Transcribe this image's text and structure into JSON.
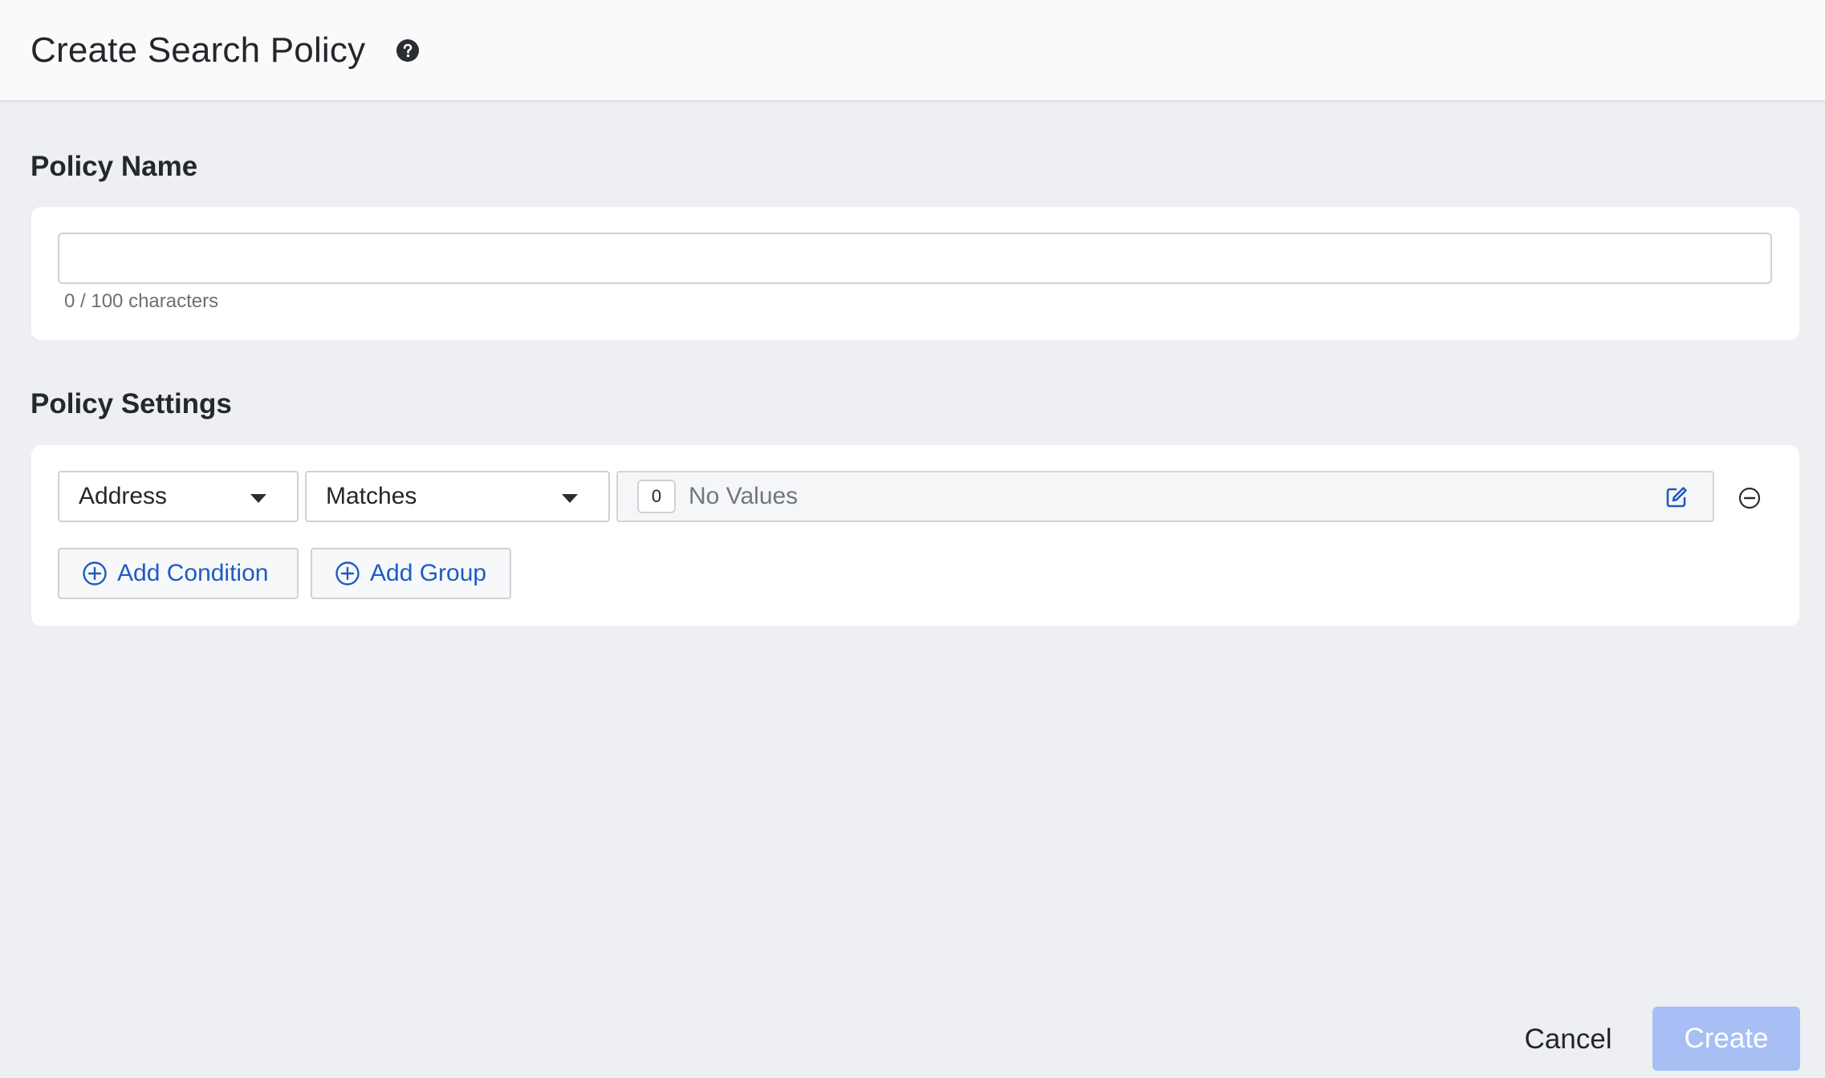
{
  "header": {
    "title": "Create Search Policy",
    "help_icon": "question-circle-icon"
  },
  "policy_name": {
    "label": "Policy Name",
    "input_value": "",
    "input_placeholder": "",
    "char_count": "0 / 100 characters",
    "max_chars": 100
  },
  "policy_settings": {
    "label": "Policy Settings",
    "condition": {
      "field": "Address",
      "operator": "Matches",
      "value_count": "0",
      "values_text": "No Values",
      "edit_icon": "pencil-square-icon",
      "remove_icon": "minus-circle-icon"
    },
    "add_condition_label": "Add Condition",
    "add_group_label": "Add Group"
  },
  "footer": {
    "cancel_label": "Cancel",
    "create_label": "Create"
  },
  "colors": {
    "accent": "#1d5bc4",
    "create_disabled": "#a7bff4",
    "background": "#eeeff2",
    "header_bg": "#fafafa"
  }
}
